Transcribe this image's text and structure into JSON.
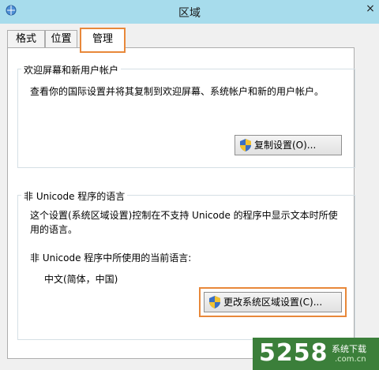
{
  "window": {
    "title": "区域",
    "close_glyph": "×"
  },
  "tabs": [
    {
      "label": "格式"
    },
    {
      "label": "位置"
    },
    {
      "label": "管理"
    }
  ],
  "welcome_section": {
    "title": "欢迎屏幕和新用户帐户",
    "description": "查看你的国际设置并将其复制到欢迎屏幕、系统帐户和新的用户帐户。",
    "button_label": "复制设置(O)..."
  },
  "unicode_section": {
    "title": "非 Unicode 程序的语言",
    "description_line1": "这个设置(系统区域设置)控制在不支持 Unicode 的程序中显示文本时所使",
    "description_line2": "用的语言。",
    "current_language_label": "非 Unicode 程序中所使用的当前语言:",
    "current_language_value": "中文(简体，中国)",
    "button_label": "更改系统区域设置(C)..."
  },
  "watermark": {
    "number": "5258",
    "site_name": "系统下载",
    "domain": ".com.cn"
  },
  "colors": {
    "titlebar": "#a7dcec",
    "highlight": "#e8883a",
    "watermark_bg": "#3b7f3a"
  }
}
